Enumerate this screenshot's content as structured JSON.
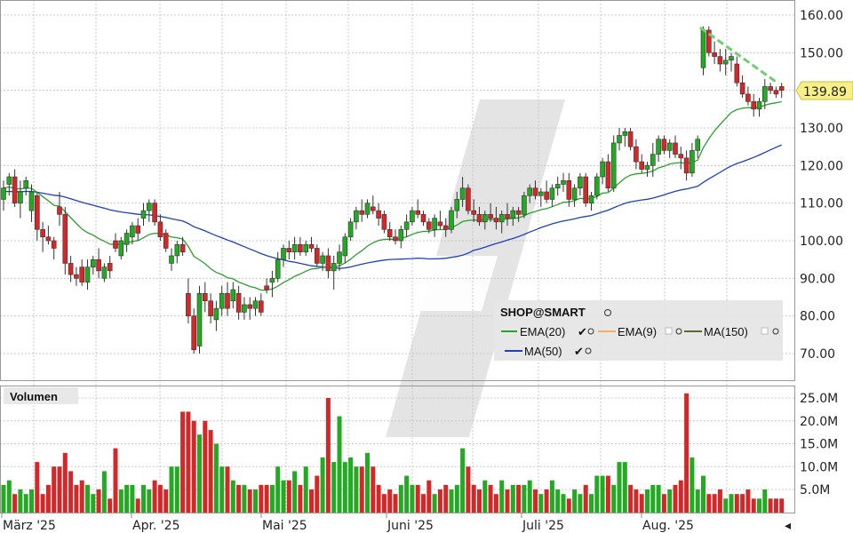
{
  "chart_data": {
    "type": "candlestick",
    "symbol": "SHOP@SMART",
    "x_tick_labels": [
      "März '25",
      "Apr. '25",
      "Mai '25",
      "Juni '25",
      "Juli '25",
      "Aug. '25"
    ],
    "price_axis": {
      "ticks": [
        "160.00",
        "150.00",
        "140.00",
        "130.00",
        "120.00",
        "110.00",
        "100.00",
        "90.00",
        "80.00",
        "70.00"
      ],
      "range": [
        64,
        163
      ]
    },
    "last_price_label": "139.89",
    "volume_panel": {
      "label": "Volumen",
      "ticks": [
        "25.0M",
        "20.0M",
        "15.0M",
        "10.0M",
        "5.0M"
      ],
      "range": [
        0,
        27
      ]
    },
    "legend": [
      {
        "name": "EMA(20)",
        "color": "#2ca02c"
      },
      {
        "name": "EMA(9)",
        "color": "#f0b060"
      },
      {
        "name": "MA(150)",
        "color": "#556b2f"
      },
      {
        "name": "MA(50)",
        "color": "#1f3fbf"
      }
    ],
    "colors": {
      "up": "#22aa22",
      "down": "#d62728",
      "grid": "#c8c8c8"
    },
    "candles": [
      [
        111,
        116,
        108,
        114,
        6
      ],
      [
        115,
        118,
        112,
        117,
        7
      ],
      [
        117,
        119,
        109,
        110,
        4
      ],
      [
        110,
        116,
        106,
        113,
        5
      ],
      [
        114,
        117,
        112,
        116,
        4
      ],
      [
        108,
        115,
        105,
        113,
        5
      ],
      [
        112,
        113,
        100,
        103,
        11
      ],
      [
        103,
        105,
        97,
        101,
        4
      ],
      [
        101,
        104,
        99,
        100,
        6
      ],
      [
        100,
        101,
        95,
        98,
        10
      ],
      [
        109,
        113,
        104,
        107,
        10
      ],
      [
        107,
        109,
        91,
        94,
        13
      ],
      [
        94,
        96,
        89,
        91,
        9
      ],
      [
        91,
        93,
        88,
        90,
        6
      ],
      [
        93,
        95,
        88,
        89,
        7
      ],
      [
        89,
        95,
        87,
        93,
        6
      ],
      [
        93,
        96,
        91,
        95,
        4
      ],
      [
        95,
        98,
        90,
        92,
        5
      ],
      [
        90,
        94,
        89,
        93,
        9
      ],
      [
        94,
        96,
        90,
        92,
        3
      ],
      [
        100,
        102,
        97,
        98,
        14
      ],
      [
        96,
        101,
        95,
        100,
        5
      ],
      [
        99,
        103,
        97,
        102,
        6
      ],
      [
        101,
        105,
        99,
        104,
        6
      ],
      [
        104,
        106,
        100,
        102,
        3
      ],
      [
        106,
        110,
        104,
        108,
        6
      ],
      [
        108,
        111,
        105,
        110,
        5
      ],
      [
        110,
        111,
        104,
        105,
        7
      ],
      [
        105,
        107,
        100,
        101,
        6
      ],
      [
        102,
        103,
        97,
        98,
        5
      ],
      [
        94,
        98,
        92,
        96,
        10
      ],
      [
        96,
        100,
        94,
        99,
        10
      ],
      [
        99,
        101,
        96,
        97,
        22
      ],
      [
        86,
        90,
        78,
        80,
        22
      ],
      [
        80,
        82,
        70,
        71,
        20
      ],
      [
        72,
        88,
        70,
        86,
        17
      ],
      [
        86,
        89,
        81,
        84,
        20
      ],
      [
        84,
        86,
        78,
        80,
        18
      ],
      [
        79,
        84,
        76,
        82,
        15
      ],
      [
        82,
        88,
        80,
        86,
        10
      ],
      [
        86,
        89,
        80,
        82,
        10
      ],
      [
        84,
        89,
        82,
        87,
        7
      ],
      [
        86,
        88,
        79,
        81,
        6
      ],
      [
        81,
        85,
        79,
        83,
        6
      ],
      [
        83,
        85,
        79,
        82,
        5
      ],
      [
        82,
        85,
        80,
        84,
        5
      ],
      [
        84,
        86,
        80,
        81,
        6
      ],
      [
        88,
        90,
        86,
        87,
        6
      ],
      [
        89,
        92,
        85,
        90,
        6
      ],
      [
        90,
        97,
        89,
        95,
        10
      ],
      [
        95,
        99,
        93,
        98,
        7
      ],
      [
        98,
        100,
        95,
        97,
        7
      ],
      [
        97,
        101,
        95,
        99,
        9
      ],
      [
        99,
        101,
        96,
        97,
        6
      ],
      [
        97,
        100,
        96,
        99,
        10
      ],
      [
        99,
        101,
        97,
        98,
        5
      ],
      [
        98,
        99,
        93,
        94,
        8
      ],
      [
        94,
        97,
        92,
        96,
        12
      ],
      [
        96,
        98,
        90,
        92,
        25
      ],
      [
        92,
        96,
        87,
        94,
        11
      ],
      [
        94,
        99,
        92,
        97,
        21
      ],
      [
        96,
        102,
        94,
        101,
        11
      ],
      [
        101,
        106,
        100,
        105,
        12
      ],
      [
        105,
        109,
        103,
        108,
        10
      ],
      [
        108,
        111,
        105,
        107,
        10
      ],
      [
        107,
        111,
        106,
        110,
        13
      ],
      [
        109,
        112,
        107,
        108,
        10
      ],
      [
        108,
        110,
        104,
        106,
        6
      ],
      [
        107,
        108,
        102,
        103,
        4
      ],
      [
        103,
        105,
        100,
        101,
        5
      ],
      [
        101,
        103,
        99,
        100,
        4
      ],
      [
        100,
        104,
        98,
        103,
        6
      ],
      [
        103,
        107,
        101,
        105,
        8
      ],
      [
        105,
        109,
        104,
        108,
        6
      ],
      [
        108,
        111,
        106,
        107,
        6
      ],
      [
        107,
        108,
        104,
        105,
        4
      ],
      [
        105,
        106,
        102,
        103,
        7
      ],
      [
        103,
        107,
        101,
        106,
        4
      ],
      [
        105,
        108,
        103,
        104,
        5
      ],
      [
        104,
        106,
        101,
        103,
        6
      ],
      [
        103,
        109,
        102,
        108,
        5
      ],
      [
        108,
        113,
        106,
        111,
        6
      ],
      [
        111,
        117,
        109,
        114,
        14
      ],
      [
        114,
        115,
        107,
        108,
        10
      ],
      [
        108,
        111,
        105,
        107,
        6
      ],
      [
        107,
        109,
        104,
        105,
        5
      ],
      [
        105,
        108,
        103,
        107,
        7
      ],
      [
        107,
        110,
        105,
        106,
        6
      ],
      [
        106,
        109,
        103,
        105,
        4
      ],
      [
        105,
        108,
        102,
        107,
        7
      ],
      [
        107,
        110,
        104,
        106,
        5
      ],
      [
        106,
        109,
        104,
        108,
        6
      ],
      [
        108,
        109,
        105,
        107,
        6
      ],
      [
        107,
        113,
        106,
        112,
        6
      ],
      [
        112,
        115,
        110,
        114,
        7
      ],
      [
        114,
        116,
        111,
        112,
        5
      ],
      [
        112,
        114,
        109,
        113,
        4
      ],
      [
        113,
        116,
        110,
        111,
        5
      ],
      [
        111,
        115,
        109,
        114,
        7
      ],
      [
        114,
        117,
        112,
        115,
        5
      ],
      [
        115,
        118,
        113,
        116,
        4
      ],
      [
        116,
        118,
        109,
        111,
        3
      ],
      [
        111,
        115,
        109,
        114,
        5
      ],
      [
        114,
        118,
        112,
        117,
        4
      ],
      [
        117,
        118,
        109,
        110,
        6
      ],
      [
        110,
        113,
        108,
        112,
        4
      ],
      [
        112,
        118,
        111,
        117,
        8
      ],
      [
        117,
        122,
        115,
        121,
        8
      ],
      [
        121,
        123,
        113,
        114,
        8
      ],
      [
        114,
        128,
        113,
        126,
        6
      ],
      [
        126,
        130,
        124,
        128,
        11
      ],
      [
        128,
        130,
        125,
        129,
        11
      ],
      [
        129,
        130,
        124,
        125,
        6
      ],
      [
        125,
        127,
        119,
        121,
        5
      ],
      [
        121,
        123,
        118,
        119,
        4
      ],
      [
        119,
        121,
        117,
        120,
        5
      ],
      [
        120,
        126,
        117,
        123,
        6
      ],
      [
        123,
        128,
        121,
        127,
        6
      ],
      [
        127,
        128,
        123,
        124,
        4
      ],
      [
        124,
        127,
        122,
        126,
        5
      ],
      [
        126,
        128,
        122,
        123,
        6
      ],
      [
        123,
        125,
        119,
        122,
        7
      ],
      [
        122,
        124,
        116,
        118,
        26
      ],
      [
        118,
        126,
        117,
        124,
        12
      ],
      [
        124,
        128,
        122,
        127,
        5
      ],
      [
        146,
        157,
        144,
        156,
        8
      ],
      [
        156,
        157,
        149,
        150,
        4
      ],
      [
        150,
        153,
        147,
        149,
        4
      ],
      [
        149,
        151,
        145,
        147,
        5
      ],
      [
        147,
        151,
        144,
        148,
        3
      ],
      [
        148,
        150,
        145,
        149,
        4
      ],
      [
        147,
        149,
        141,
        142,
        4
      ],
      [
        142,
        144,
        138,
        139,
        4
      ],
      [
        139,
        141,
        136,
        137,
        5
      ],
      [
        137,
        139,
        133,
        135,
        3
      ],
      [
        135,
        138,
        133,
        137,
        3
      ],
      [
        137,
        143,
        135,
        141,
        5
      ],
      [
        141,
        142,
        139,
        140,
        3
      ],
      [
        140,
        141,
        138,
        139,
        3
      ],
      [
        141,
        142,
        138,
        140,
        3
      ]
    ]
  }
}
